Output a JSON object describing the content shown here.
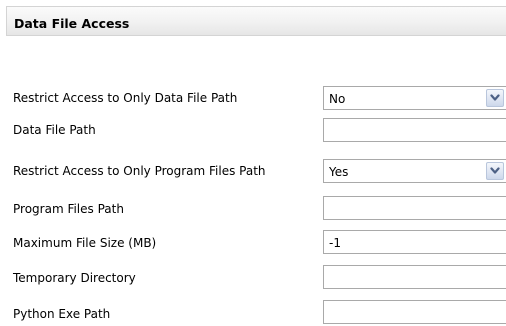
{
  "section": {
    "title": "Data File Access"
  },
  "rows": [
    {
      "label": "Restrict Access to Only Data File Path",
      "type": "select",
      "value": "No"
    },
    {
      "label": "Data File Path",
      "type": "text",
      "value": ""
    },
    {
      "label": "Restrict Access to Only Program Files Path",
      "type": "select",
      "value": "Yes"
    },
    {
      "label": "Program Files Path",
      "type": "text",
      "value": ""
    },
    {
      "label": "Maximum File Size (MB)",
      "type": "text",
      "value": "-1"
    },
    {
      "label": "Temporary Directory",
      "type": "text",
      "value": ""
    },
    {
      "label": "Python Exe Path",
      "type": "text",
      "value": ""
    }
  ],
  "icons": {
    "dropdown": "chevron-down-icon"
  },
  "colors": {
    "field_border": "#a9a9a9",
    "header_border": "#d4d4d4",
    "dropdown_arrow": "#4d6185"
  }
}
